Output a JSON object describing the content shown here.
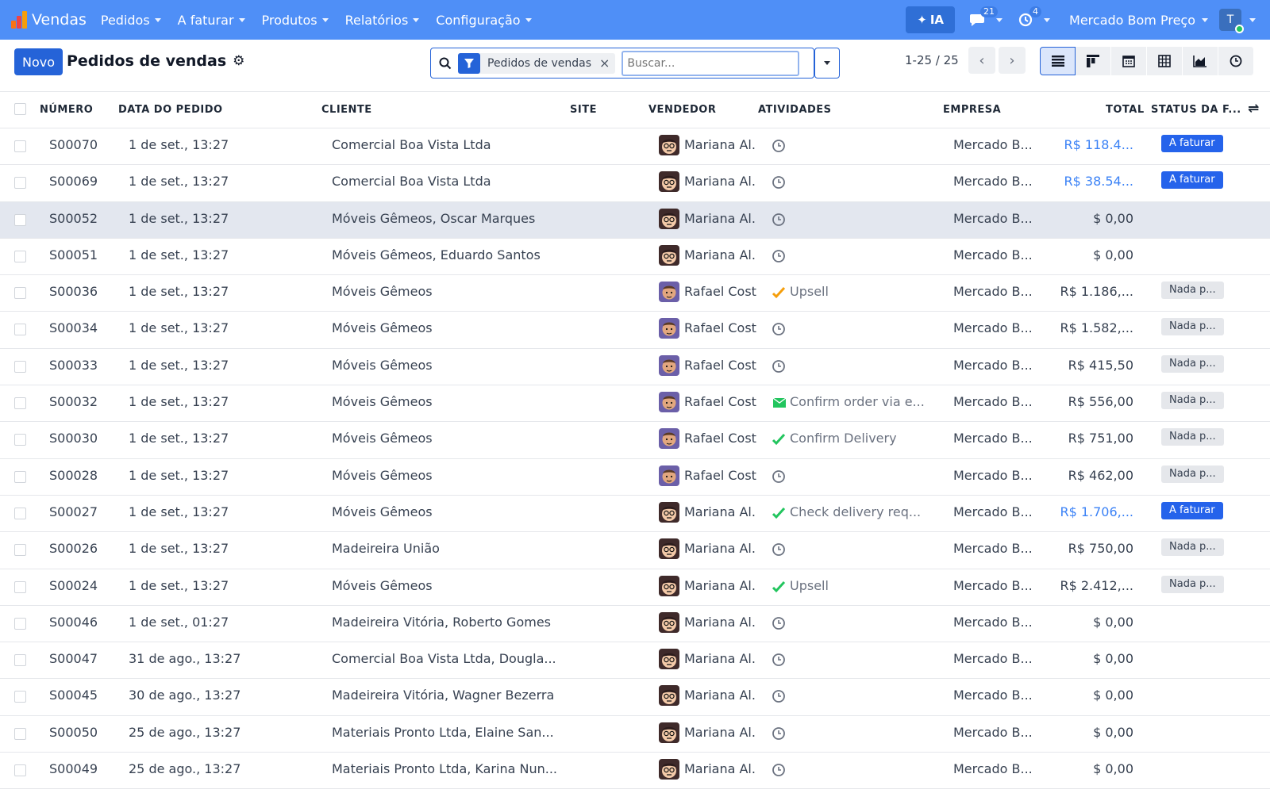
{
  "navbar": {
    "app_name": "Vendas",
    "menus": [
      "Pedidos",
      "A faturar",
      "Produtos",
      "Relatórios",
      "Configuração"
    ],
    "ai_label": "IA",
    "messages_count": "21",
    "activities_count": "4",
    "company": "Mercado Bom Preço",
    "user_initial": "T"
  },
  "control": {
    "new_label": "Novo",
    "title": "Pedidos de vendas",
    "facet_label": "Pedidos de vendas",
    "search_placeholder": "Buscar...",
    "pager": "1-25 / 25"
  },
  "columns": {
    "number": "NÚMERO",
    "date": "DATA DO PEDIDO",
    "customer": "CLIENTE",
    "site": "SITE",
    "salesperson": "VENDEDOR",
    "activities": "ATIVIDADES",
    "company": "EMPRESA",
    "total": "TOTAL",
    "invoice_status": "STATUS DA F..."
  },
  "rows": [
    {
      "number": "S00070",
      "date": "1 de set., 13:27",
      "customer": "Comercial Boa Vista Ltda",
      "salesperson": "Mariana Al.",
      "avatar": "mariana",
      "activity_icon": "clock-icon",
      "activity": "",
      "company": "Mercado B...",
      "total": "R$ 118.4...",
      "total_link": true,
      "status": "A faturar",
      "status_style": "blue"
    },
    {
      "number": "S00069",
      "date": "1 de set., 13:27",
      "customer": "Comercial Boa Vista Ltda",
      "salesperson": "Mariana Al.",
      "avatar": "mariana",
      "activity_icon": "clock-icon",
      "activity": "",
      "company": "Mercado B...",
      "total": "R$ 38.54...",
      "total_link": true,
      "status": "A faturar",
      "status_style": "blue"
    },
    {
      "number": "S00052",
      "date": "1 de set., 13:27",
      "customer": "Móveis Gêmeos, Oscar Marques",
      "salesperson": "Mariana Al.",
      "avatar": "mariana",
      "activity_icon": "clock-icon",
      "activity": "",
      "company": "Mercado B...",
      "total": "$ 0,00",
      "total_link": false,
      "status": "",
      "status_style": "",
      "highlight": true
    },
    {
      "number": "S00051",
      "date": "1 de set., 13:27",
      "customer": "Móveis Gêmeos, Eduardo Santos",
      "salesperson": "Mariana Al.",
      "avatar": "mariana",
      "activity_icon": "clock-icon",
      "activity": "",
      "company": "Mercado B...",
      "total": "$ 0,00",
      "total_link": false,
      "status": "",
      "status_style": ""
    },
    {
      "number": "S00036",
      "date": "1 de set., 13:27",
      "customer": "Móveis Gêmeos",
      "salesperson": "Rafael Cost",
      "avatar": "rafael",
      "activity_icon": "check-orange-icon",
      "activity": "Upsell",
      "company": "Mercado B...",
      "total": "R$ 1.186,...",
      "total_link": false,
      "status": "Nada p...",
      "status_style": "grey"
    },
    {
      "number": "S00034",
      "date": "1 de set., 13:27",
      "customer": "Móveis Gêmeos",
      "salesperson": "Rafael Cost",
      "avatar": "rafael",
      "activity_icon": "clock-icon",
      "activity": "",
      "company": "Mercado B...",
      "total": "R$ 1.582,...",
      "total_link": false,
      "status": "Nada p...",
      "status_style": "grey"
    },
    {
      "number": "S00033",
      "date": "1 de set., 13:27",
      "customer": "Móveis Gêmeos",
      "salesperson": "Rafael Cost",
      "avatar": "rafael",
      "activity_icon": "clock-icon",
      "activity": "",
      "company": "Mercado B...",
      "total": "R$ 415,50",
      "total_link": false,
      "status": "Nada p...",
      "status_style": "grey"
    },
    {
      "number": "S00032",
      "date": "1 de set., 13:27",
      "customer": "Móveis Gêmeos",
      "salesperson": "Rafael Cost",
      "avatar": "rafael",
      "activity_icon": "envelope-icon",
      "activity": "Confirm order via e...",
      "company": "Mercado B...",
      "total": "R$ 556,00",
      "total_link": false,
      "status": "Nada p...",
      "status_style": "grey"
    },
    {
      "number": "S00030",
      "date": "1 de set., 13:27",
      "customer": "Móveis Gêmeos",
      "salesperson": "Rafael Cost",
      "avatar": "rafael",
      "activity_icon": "check-green-icon",
      "activity": "Confirm Delivery",
      "company": "Mercado B...",
      "total": "R$ 751,00",
      "total_link": false,
      "status": "Nada p...",
      "status_style": "grey"
    },
    {
      "number": "S00028",
      "date": "1 de set., 13:27",
      "customer": "Móveis Gêmeos",
      "salesperson": "Rafael Cost",
      "avatar": "rafael",
      "activity_icon": "clock-icon",
      "activity": "",
      "company": "Mercado B...",
      "total": "R$ 462,00",
      "total_link": false,
      "status": "Nada p...",
      "status_style": "grey"
    },
    {
      "number": "S00027",
      "date": "1 de set., 13:27",
      "customer": "Móveis Gêmeos",
      "salesperson": "Mariana Al.",
      "avatar": "mariana",
      "activity_icon": "check-green-icon",
      "activity": "Check delivery req...",
      "company": "Mercado B...",
      "total": "R$ 1.706,...",
      "total_link": true,
      "status": "A faturar",
      "status_style": "blue"
    },
    {
      "number": "S00026",
      "date": "1 de set., 13:27",
      "customer": "Madeireira União",
      "salesperson": "Mariana Al.",
      "avatar": "mariana",
      "activity_icon": "clock-icon",
      "activity": "",
      "company": "Mercado B...",
      "total": "R$ 750,00",
      "total_link": false,
      "status": "Nada p...",
      "status_style": "grey"
    },
    {
      "number": "S00024",
      "date": "1 de set., 13:27",
      "customer": "Móveis Gêmeos",
      "salesperson": "Mariana Al.",
      "avatar": "mariana",
      "activity_icon": "check-green-icon",
      "activity": "Upsell",
      "company": "Mercado B...",
      "total": "R$ 2.412,...",
      "total_link": false,
      "status": "Nada p...",
      "status_style": "grey"
    },
    {
      "number": "S00046",
      "date": "1 de set., 01:27",
      "customer": "Madeireira Vitória, Roberto Gomes",
      "salesperson": "Mariana Al.",
      "avatar": "mariana",
      "activity_icon": "clock-icon",
      "activity": "",
      "company": "Mercado B...",
      "total": "$ 0,00",
      "total_link": false,
      "status": "",
      "status_style": ""
    },
    {
      "number": "S00047",
      "date": "31 de ago., 13:27",
      "customer": "Comercial Boa Vista Ltda, Dougla...",
      "salesperson": "Mariana Al.",
      "avatar": "mariana",
      "activity_icon": "clock-icon",
      "activity": "",
      "company": "Mercado B...",
      "total": "$ 0,00",
      "total_link": false,
      "status": "",
      "status_style": ""
    },
    {
      "number": "S00045",
      "date": "30 de ago., 13:27",
      "customer": "Madeireira Vitória, Wagner Bezerra",
      "salesperson": "Mariana Al.",
      "avatar": "mariana",
      "activity_icon": "clock-icon",
      "activity": "",
      "company": "Mercado B...",
      "total": "$ 0,00",
      "total_link": false,
      "status": "",
      "status_style": ""
    },
    {
      "number": "S00050",
      "date": "25 de ago., 13:27",
      "customer": "Materiais Pronto Ltda, Elaine San...",
      "salesperson": "Mariana Al.",
      "avatar": "mariana",
      "activity_icon": "clock-icon",
      "activity": "",
      "company": "Mercado B...",
      "total": "$ 0,00",
      "total_link": false,
      "status": "",
      "status_style": ""
    },
    {
      "number": "S00049",
      "date": "25 de ago., 13:27",
      "customer": "Materiais Pronto Ltda, Karina Nun...",
      "salesperson": "Mariana Al.",
      "avatar": "mariana",
      "activity_icon": "clock-icon",
      "activity": "",
      "company": "Mercado B...",
      "total": "$ 0,00",
      "total_link": false,
      "status": "",
      "status_style": ""
    }
  ],
  "colors": {
    "navbar": "#4f8ff7",
    "primary": "#2563d8",
    "link": "#3b82f6",
    "badge_blue": "#2563eb",
    "badge_grey": "#e5e7eb",
    "highlight_row": "#e3e7ef"
  }
}
